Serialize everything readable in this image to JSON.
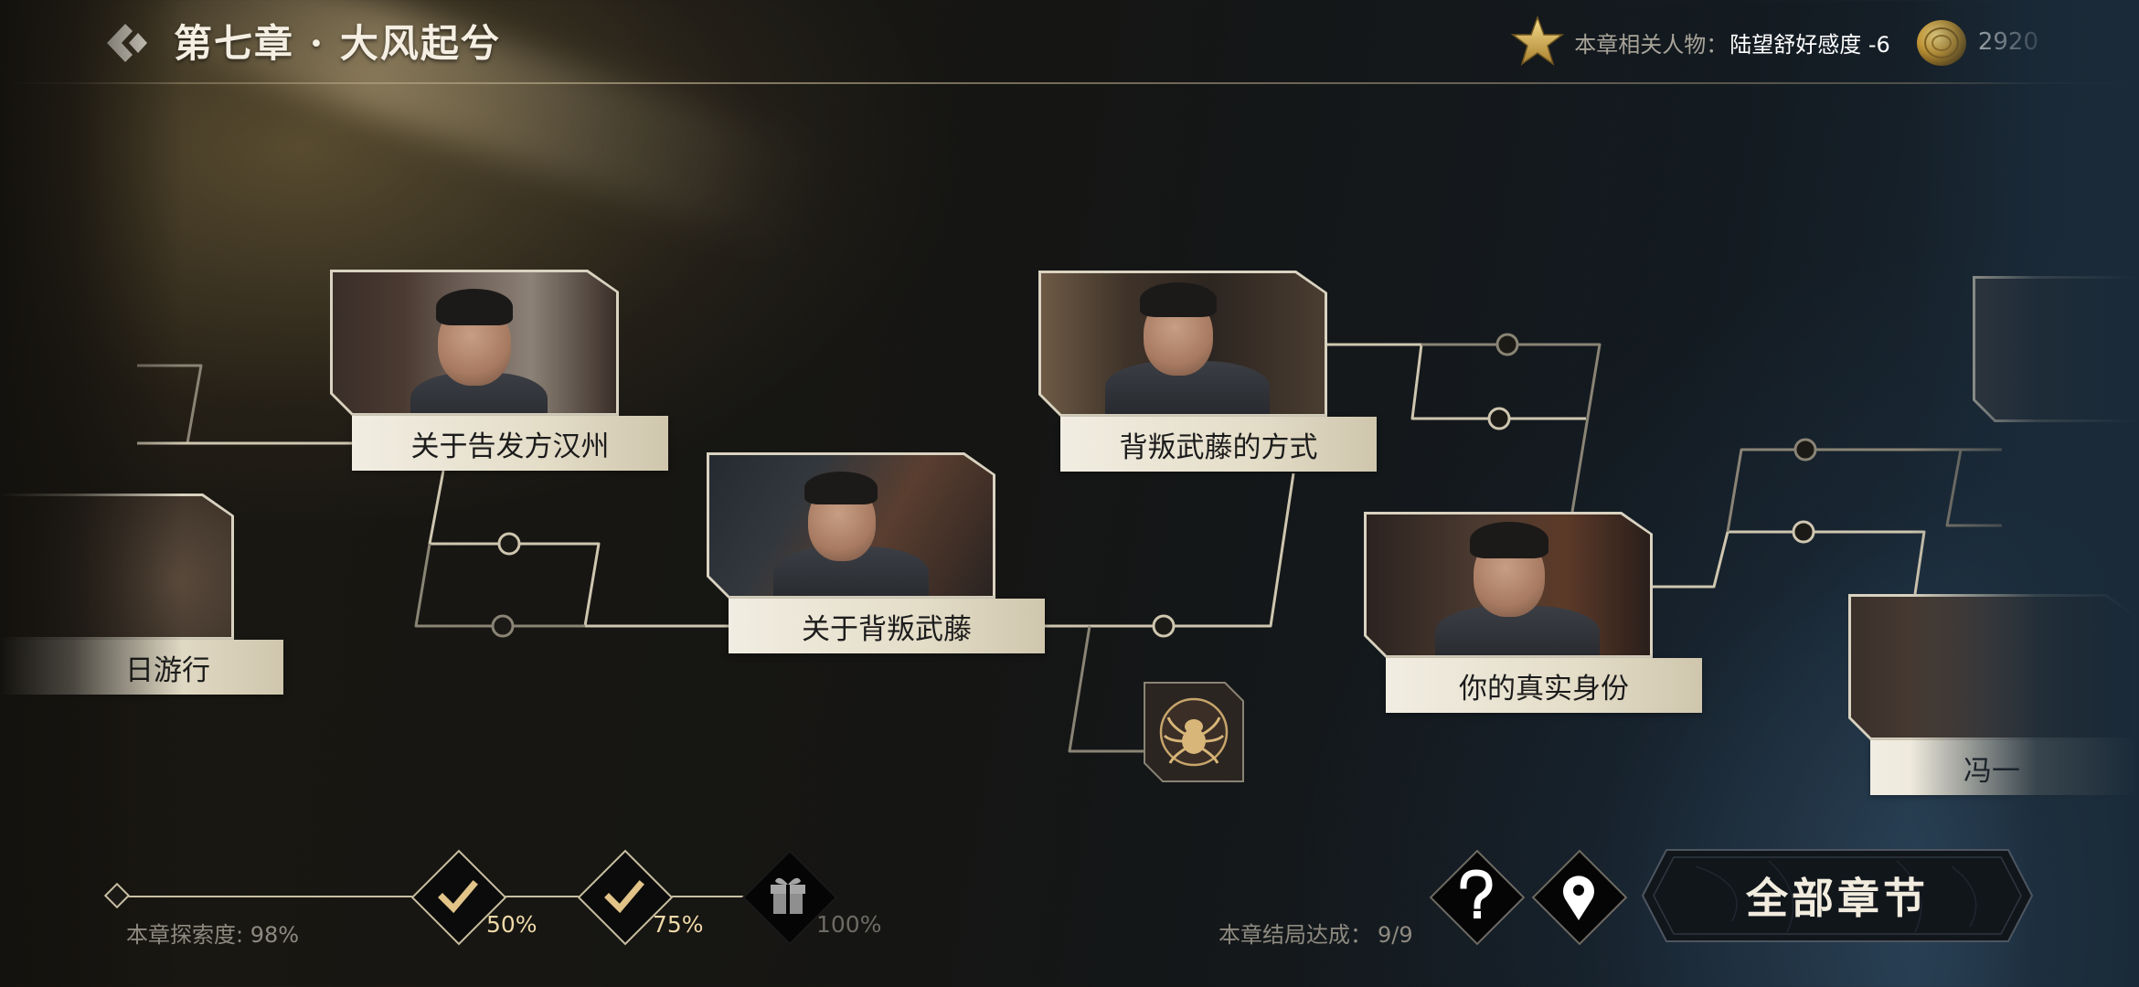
{
  "header": {
    "title": "第七章 · 大风起兮",
    "relation_label": "本章相关人物：",
    "relation_value": "陆望舒好感度 -6",
    "coins": "2920"
  },
  "nodes": [
    {
      "label": "日游行"
    },
    {
      "label": "关于告发方汉州"
    },
    {
      "label": "关于背叛武藤"
    },
    {
      "label": "背叛武藤的方式"
    },
    {
      "label": "你的真实身份"
    },
    {
      "label": "冯一"
    }
  ],
  "progress": {
    "explore_label": "本章探索度:",
    "explore_value": "98%",
    "milestones": [
      {
        "pct": "50%",
        "state": "done"
      },
      {
        "pct": "75%",
        "state": "done"
      },
      {
        "pct": "100%",
        "state": "locked"
      }
    ],
    "ending_label": "本章结局达成：",
    "ending_value": "9/9"
  },
  "buttons": {
    "all_chapters": "全部章节"
  },
  "icons": {
    "back": "back-chevron-icon",
    "star": "star-icon",
    "coin": "coin-icon",
    "check": "check-icon",
    "gift": "gift-icon",
    "help": "question-icon",
    "location": "location-pin-icon",
    "item": "spider-emblem-icon"
  },
  "colors": {
    "accent_gold": "#c9bfa4",
    "label_bg": "#ebe5d4",
    "check_gold": "#e2c489"
  }
}
